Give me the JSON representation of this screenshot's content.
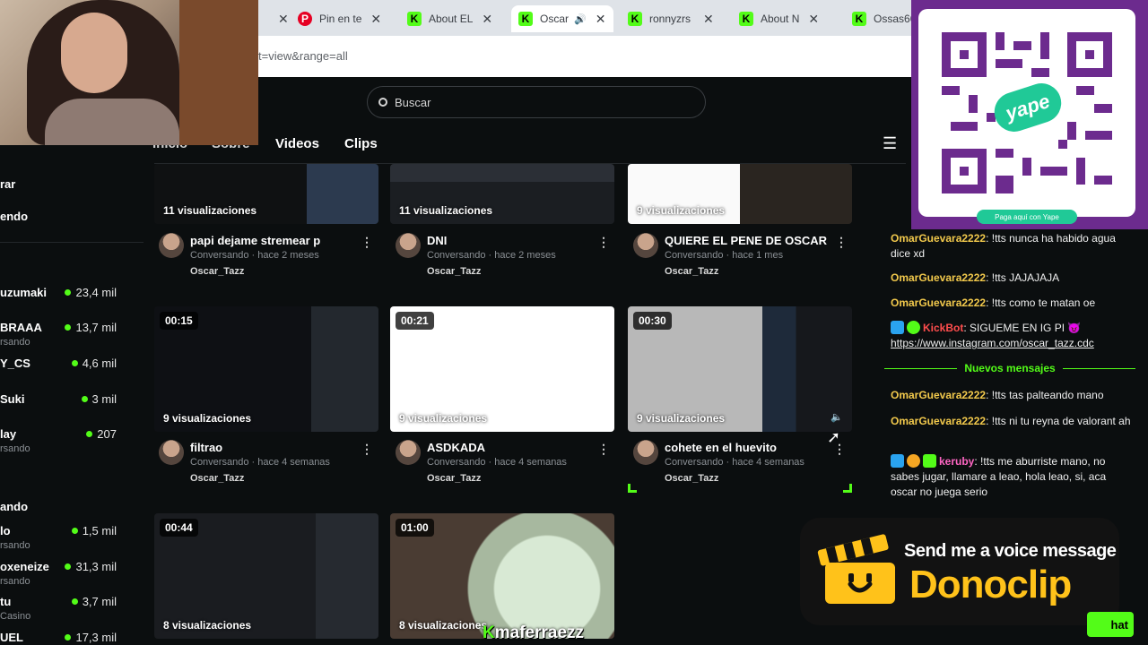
{
  "browser": {
    "tabs": [
      {
        "label": "",
        "favicon": "close",
        "active": false
      },
      {
        "label": "Pin en te",
        "favicon": "pinterest-icon",
        "active": false
      },
      {
        "label": "About EL",
        "favicon": "kick-icon",
        "active": false
      },
      {
        "label": "Oscar",
        "favicon": "kick-icon",
        "active": true
      },
      {
        "label": "ronnyzrs",
        "favicon": "kick-icon",
        "active": false
      },
      {
        "label": "About N",
        "favicon": "kick-icon",
        "active": false
      },
      {
        "label": "Ossas66",
        "favicon": "kick-icon",
        "active": false
      }
    ],
    "url": "t=view&range=all"
  },
  "site": {
    "search_placeholder": "Buscar",
    "nav": {
      "inicio": "Inicio",
      "sobre": "Sobre",
      "videos": "Videos",
      "clips": "Clips"
    }
  },
  "sidebar": {
    "items": [
      {
        "label": "rar"
      },
      {
        "label": "endo"
      }
    ],
    "channels": [
      {
        "name": "uzumaki",
        "sub": "",
        "viewers": "23,4 mil"
      },
      {
        "name": "BRAAA",
        "sub": "rsando",
        "viewers": "13,7 mil"
      },
      {
        "name": "Y_CS",
        "sub": "",
        "viewers": "4,6 mil"
      },
      {
        "name": "Suki",
        "sub": "",
        "viewers": "3 mil"
      },
      {
        "name": "lay",
        "sub": "rsando",
        "viewers": "207"
      }
    ],
    "section2": "ando",
    "channels2": [
      {
        "name": "lo",
        "sub": "rsando",
        "viewers": "1,5 mil"
      },
      {
        "name": "oxeneize",
        "sub": "rsando",
        "viewers": "31,3 mil"
      },
      {
        "name": "tu",
        "sub": "Casino",
        "viewers": "3,7 mil"
      },
      {
        "name": "UEL",
        "sub": "",
        "viewers": "17,3 mil"
      }
    ]
  },
  "clips": [
    {
      "duration": "",
      "views": "11 visualizaciones",
      "title": "papi dejame stremear p",
      "meta": "Conversando · hace 2 meses",
      "channel": "Oscar_Tazz"
    },
    {
      "duration": "",
      "views": "11 visualizaciones",
      "title": "DNI",
      "meta": "Conversando · hace 2 meses",
      "channel": "Oscar_Tazz"
    },
    {
      "duration": "",
      "views": "9 visualizaciones",
      "title": "QUIERE EL PENE DE OSCAR",
      "meta": "Conversando · hace 1 mes",
      "channel": "Oscar_Tazz"
    },
    {
      "duration": "00:15",
      "views": "9 visualizaciones",
      "title": "filtrao",
      "meta": "Conversando · hace 4 semanas",
      "channel": "Oscar_Tazz"
    },
    {
      "duration": "00:21",
      "views": "9 visualizaciones",
      "title": "ASDKADA",
      "meta": "Conversando · hace 4 semanas",
      "channel": "Oscar_Tazz"
    },
    {
      "duration": "00:30",
      "views": "9 visualizaciones",
      "title": "cohete en el huevito",
      "meta": "Conversando · hace 4 semanas",
      "channel": "Oscar_Tazz"
    },
    {
      "duration": "00:44",
      "views": "8 visualizaciones",
      "title": "",
      "meta": "",
      "channel": ""
    },
    {
      "duration": "01:00",
      "views": "8 visualizaciones",
      "title": "",
      "meta": "",
      "channel": ""
    }
  ],
  "qr": {
    "brand": "yape",
    "caption": "Paga aquí con Yape"
  },
  "chat": {
    "messages": [
      {
        "user": "OmarGuevara2222",
        "text": "!tts nunca ha habido agua dice xd"
      },
      {
        "user": "OmarGuevara2222",
        "text": "!tts JAJAJAJA"
      },
      {
        "user": "OmarGuevara2222",
        "text": "!tts como te matan oe"
      },
      {
        "user": "KickBot",
        "text": "SIGUEME EN IG PI",
        "link": "https://www.instagram.com/oscar_tazz.cdc"
      },
      {
        "user": "OmarGuevara2222",
        "text": "!tts tas palteando mano"
      },
      {
        "user": "OmarGuevara2222",
        "text": "!tts ni tu reyna de valorant ah"
      },
      {
        "user": "keruby",
        "text": "!tts me aburriste mano, no sabes jugar, llamare a leao, hola leao, si, aca oscar no juega serio"
      }
    ],
    "new_messages_label": "Nuevos mensajes",
    "chat_button": "hat"
  },
  "donoclip": {
    "tagline": "Send me a voice message",
    "brand": "Donoclip"
  },
  "watermark": {
    "name": "maferraezz"
  },
  "colors": {
    "accent": "#53fc18",
    "username": "#f2c94c",
    "yape": "#6c2b8e",
    "donoclip": "#ffc21a"
  }
}
